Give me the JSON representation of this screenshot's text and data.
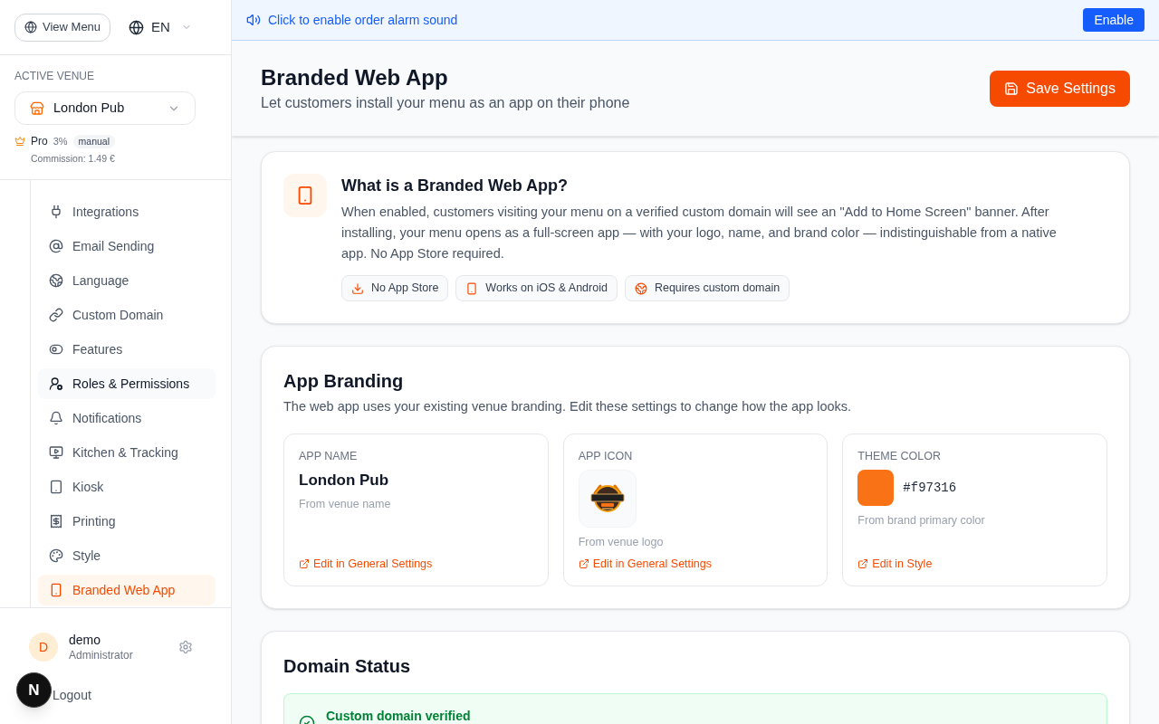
{
  "sidebar": {
    "view_menu_button": "View Menu",
    "language": "EN",
    "active_venue": {
      "label": "ACTIVE VENUE",
      "venue": "London Pub",
      "plan": "Pro",
      "rate": "3%",
      "mode_badge": "manual",
      "commission": "Commission: 1.49 €"
    },
    "nav_items": [
      {
        "label": "Integrations",
        "selected": false,
        "hovered": false
      },
      {
        "label": "Email Sending",
        "selected": false,
        "hovered": false
      },
      {
        "label": "Language",
        "selected": false,
        "hovered": false
      },
      {
        "label": "Custom Domain",
        "selected": false,
        "hovered": false
      },
      {
        "label": "Features",
        "selected": false,
        "hovered": false
      },
      {
        "label": "Roles & Permissions",
        "selected": false,
        "hovered": true
      },
      {
        "label": "Notifications",
        "selected": false,
        "hovered": false
      },
      {
        "label": "Kitchen & Tracking",
        "selected": false,
        "hovered": false
      },
      {
        "label": "Kiosk",
        "selected": false,
        "hovered": false
      },
      {
        "label": "Printing",
        "selected": false,
        "hovered": false
      },
      {
        "label": "Style",
        "selected": false,
        "hovered": false
      },
      {
        "label": "Branded Web App",
        "selected": true,
        "hovered": false
      }
    ],
    "user": {
      "avatar_initial": "D",
      "name": "demo",
      "role": "Administrator"
    },
    "logout": "Logout"
  },
  "dev_badge": "N",
  "alarm_banner": {
    "text": "Click to enable order alarm sound",
    "button": "Enable"
  },
  "header": {
    "title": "Branded Web App",
    "subtitle": "Let customers install your menu as an app on their phone",
    "save_button": "Save Settings"
  },
  "info_card": {
    "title": "What is a Branded Web App?",
    "text": "When enabled, customers visiting your menu on a verified custom domain will see an \"Add to Home Screen\" banner. After installing, your menu opens as a full-screen app — with your logo, name, and brand color — indistinguishable from a native app. No App Store required.",
    "chips": [
      "No App Store",
      "Works on iOS & Android",
      "Requires custom domain"
    ]
  },
  "branding_card": {
    "title": "App Branding",
    "description": "The web app uses your existing venue branding. Edit these settings to change how the app looks.",
    "tiles": [
      {
        "kind": "name",
        "label": "APP NAME",
        "value": "London Pub",
        "note": "From venue name",
        "link": "Edit in General Settings"
      },
      {
        "kind": "icon",
        "label": "APP ICON",
        "note": "From venue logo",
        "link": "Edit in General Settings"
      },
      {
        "kind": "color",
        "label": "THEME COLOR",
        "value": "#f97316",
        "color": "#f97316",
        "note": "From brand primary color",
        "link": "Edit in Style"
      }
    ]
  },
  "domain_card": {
    "title": "Domain Status",
    "status": {
      "text": "Custom domain verified",
      "verified": true
    }
  }
}
